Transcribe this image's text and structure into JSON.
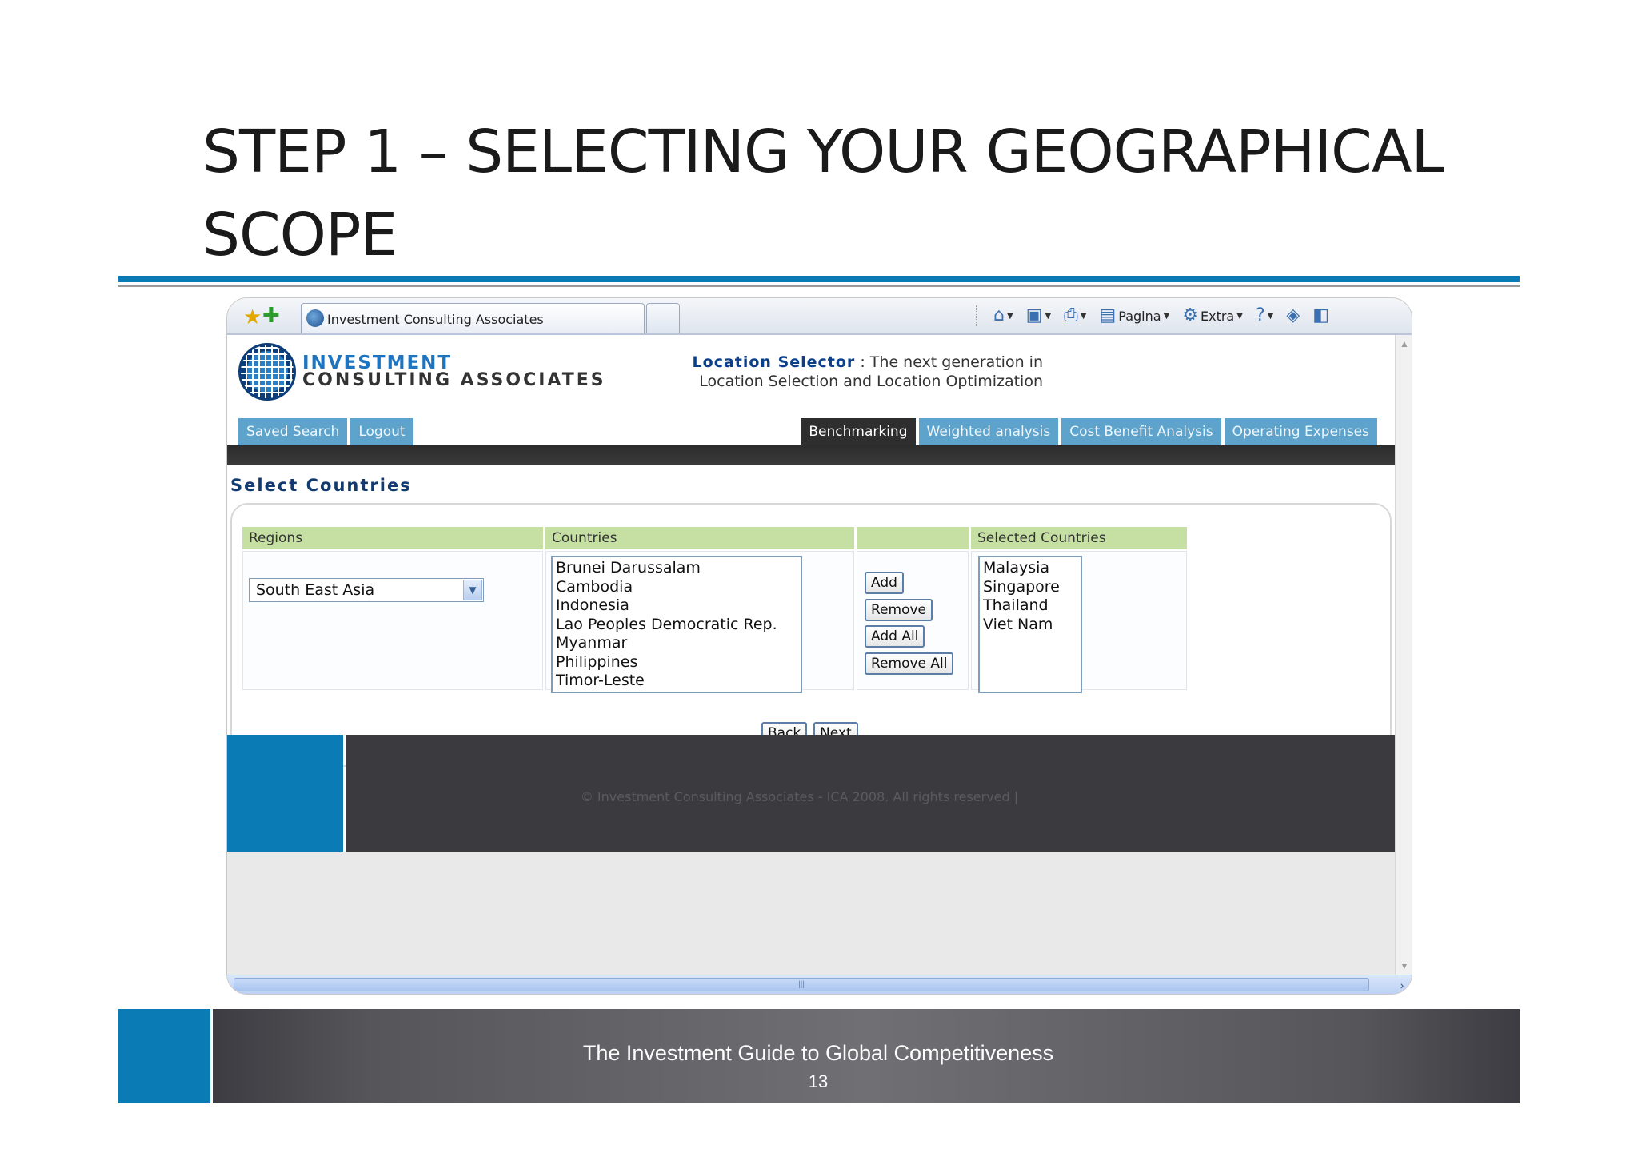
{
  "slide": {
    "title_line1": "STEP 1 – SELECTING YOUR GEOGRAPHICAL",
    "title_line2": "SCOPE",
    "footer_title": "The Investment Guide to Global Competitiveness",
    "page_number": "13"
  },
  "browser": {
    "tab_title": "Investment Consulting Associates",
    "command_bar": {
      "home": "home-icon",
      "feeds": "rss-icon",
      "print": "printer-icon",
      "page_label": "Pagina",
      "tools_label": "Extra",
      "help": "help-icon"
    }
  },
  "site": {
    "logo_line1": "INVESTMENT",
    "logo_line2": "CONSULTING ASSOCIATES",
    "tagline_brand": "Location Selector",
    "tagline_text": " : The next generation in Location Selection and Location Optimization",
    "nav_left": [
      "Saved Search",
      "Logout"
    ],
    "nav_right": [
      "Benchmarking",
      "Weighted analysis",
      "Cost Benefit Analysis",
      "Operating Expenses"
    ],
    "nav_active": "Benchmarking",
    "section_title": "Select Countries",
    "columns": {
      "regions": "Regions",
      "countries": "Countries",
      "actions": "",
      "selected": "Selected Countries"
    },
    "region_value": "South East Asia",
    "countries": [
      "Brunei Darussalam",
      "Cambodia",
      "Indonesia",
      "Lao Peoples Democratic Rep.",
      "Myanmar",
      "Philippines",
      "Timor-Leste"
    ],
    "actions": [
      "Add",
      "Remove",
      "Add All",
      "Remove All"
    ],
    "selected_countries": [
      "Malaysia",
      "Singapore",
      "Thailand",
      "Viet Nam"
    ],
    "back_label": "Back",
    "next_label": "Next",
    "copyright": "© Investment Consulting Associates - ICA 2008. All rights reserved   |"
  }
}
